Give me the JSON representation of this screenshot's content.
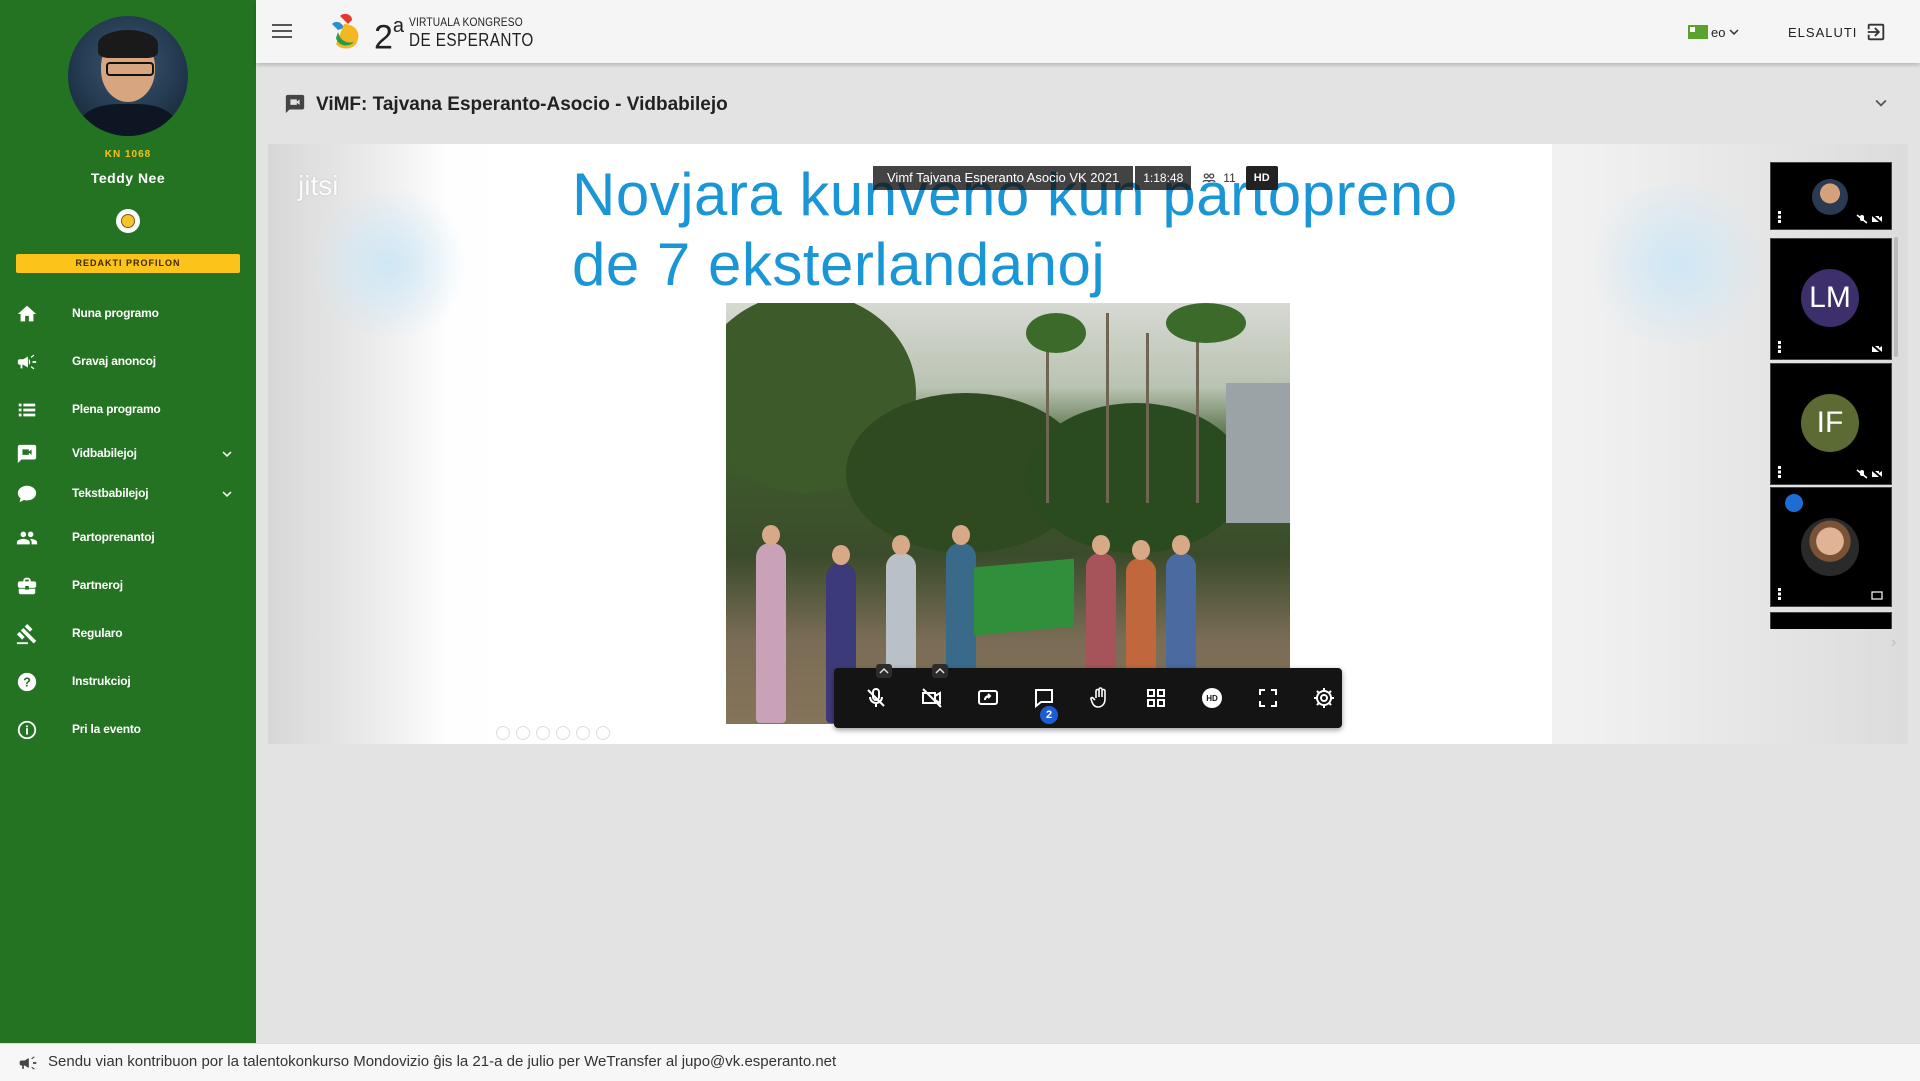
{
  "user": {
    "member_id": "KN 1068",
    "name": "Teddy Nee",
    "edit_profile_label": "REDAKTI PROFILON"
  },
  "sidebar": {
    "items": [
      {
        "label": "Nuna programo",
        "icon": "home-icon"
      },
      {
        "label": "Gravaj anoncoj",
        "icon": "megaphone-icon"
      },
      {
        "label": "Plena programo",
        "icon": "list-icon"
      },
      {
        "label": "Vidbabilejoj",
        "icon": "video-chat-icon",
        "expandable": true
      },
      {
        "label": "Tekstbabilejoj",
        "icon": "chat-bubble-icon",
        "expandable": true
      },
      {
        "label": "Partoprenantoj",
        "icon": "people-icon"
      },
      {
        "label": "Partneroj",
        "icon": "briefcase-icon"
      },
      {
        "label": "Regularo",
        "icon": "gavel-icon"
      },
      {
        "label": "Instrukcioj",
        "icon": "help-icon"
      },
      {
        "label": "Pri la evento",
        "icon": "info-icon"
      }
    ]
  },
  "header": {
    "logo_number": "2",
    "logo_sup": "a",
    "logo_line1": "VIRTUALA KONGRESO",
    "logo_line2": "DE ESPERANTO",
    "language": "eo",
    "logout_label": "ELSALUTI"
  },
  "room": {
    "title": "ViMF: Tajvana Esperanto-Asocio - Vidbabilejo"
  },
  "meeting": {
    "brand": "jitsi",
    "recording_name": "Vimf Tajvana Esperanto Asocio VK 2021",
    "duration": "1:18:48",
    "participant_count": "11",
    "quality": "HD",
    "slide_title": "Novjara kunveno kun partopreno de 7 eksterlandanoj",
    "chat_unread": "2",
    "toolbar_icons": [
      "mic-muted-icon",
      "camera-off-icon",
      "share-screen-icon",
      "chat-icon",
      "raise-hand-icon",
      "tile-view-icon",
      "hd-icon",
      "fullscreen-icon",
      "settings-icon"
    ],
    "participants": [
      {
        "type": "photo",
        "name": "participant-1"
      },
      {
        "type": "initials",
        "initials": "LM",
        "color": "#3c2f6b"
      },
      {
        "type": "initials",
        "initials": "IF",
        "color": "#5b6b33"
      },
      {
        "type": "photo",
        "name": "participant-4"
      }
    ]
  },
  "footer": {
    "announcement": "Sendu vian kontribuon por la talentokonkurso Mondovizio ĝis la 21-a de julio per WeTransfer al jupo@vk.esperanto.net"
  },
  "colors": {
    "sidebar": "#247322",
    "accent": "#fcc31a",
    "slide_title": "#1a95d6"
  }
}
